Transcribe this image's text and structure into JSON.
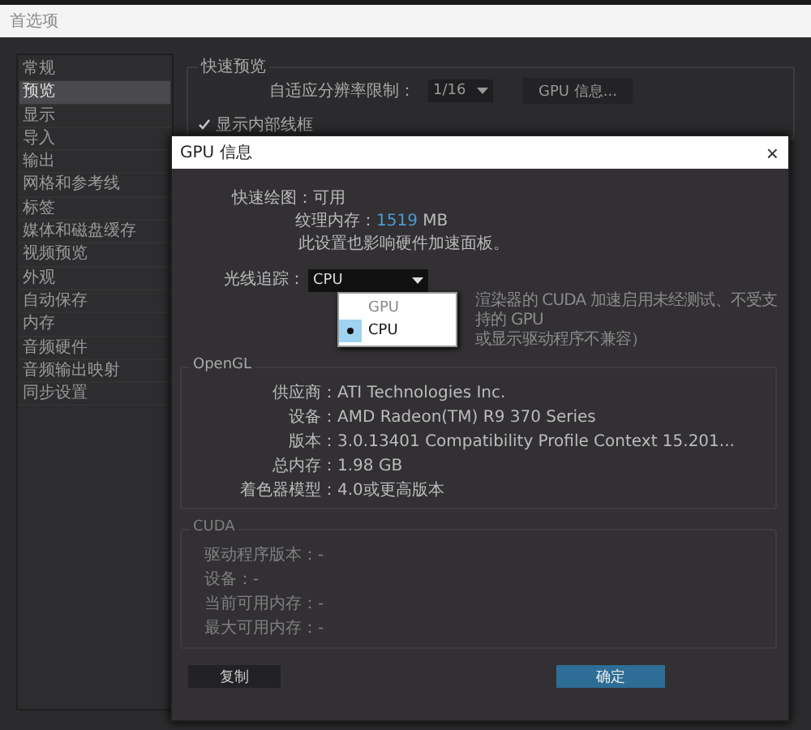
{
  "window": {
    "title": "首选项"
  },
  "sidebar": {
    "items": [
      {
        "label": "常规",
        "selected": false
      },
      {
        "label": "预览",
        "selected": true
      },
      {
        "label": "显示",
        "selected": false
      },
      {
        "label": "导入",
        "selected": false
      },
      {
        "label": "输出",
        "selected": false
      },
      {
        "label": "网格和参考线",
        "selected": false
      },
      {
        "label": "标签",
        "selected": false
      },
      {
        "label": "媒体和磁盘缓存",
        "selected": false
      },
      {
        "label": "视频预览",
        "selected": false
      },
      {
        "label": "外观",
        "selected": false
      },
      {
        "label": "自动保存",
        "selected": false
      },
      {
        "label": "内存",
        "selected": false
      },
      {
        "label": "音频硬件",
        "selected": false
      },
      {
        "label": "音频输出映射",
        "selected": false
      },
      {
        "label": "同步设置",
        "selected": false
      }
    ]
  },
  "preview_group": {
    "title": "快速预览",
    "resolution_label": "自适应分辨率限制：",
    "resolution_value": "1/16",
    "gpu_info_button": "GPU 信息...",
    "show_wireframe": {
      "label": "显示内部线框",
      "checked": true
    }
  },
  "dialog": {
    "title": "GPU 信息",
    "close": "×",
    "fast_draw": "快速绘图：可用",
    "texture_label": "纹理内存：",
    "texture_value": "1519",
    "texture_unit": " MB",
    "note": "此设置也影响硬件加速面板。",
    "raytrace_label": "光线追踪：",
    "raytrace_value": "CPU",
    "raytrace_options": [
      {
        "label": "GPU",
        "selected": false
      },
      {
        "label": "CPU",
        "selected": true
      }
    ],
    "warning_lines": [
      "渲染器的 CUDA 加速启用未经测试、不受支持的 GPU",
      "或显示驱动程序不兼容）"
    ],
    "opengl": {
      "title": "OpenGL",
      "disabled": false,
      "rows": [
        {
          "label": "供应商：",
          "value": "ATI Technologies Inc."
        },
        {
          "label": "设备：",
          "value": "AMD Radeon(TM) R9 370 Series"
        },
        {
          "label": "版本：",
          "value": "3.0.13401 Compatibility Profile Context 15.201..."
        },
        {
          "label": "总内存：",
          "value": "1.98 GB"
        },
        {
          "label": "着色器模型：",
          "value": "4.0或更高版本"
        }
      ]
    },
    "cuda": {
      "title": "CUDA",
      "disabled": true,
      "rows": [
        {
          "text": "驱动程序版本：-"
        },
        {
          "text": "设备：-"
        },
        {
          "text": "当前可用内存：-"
        },
        {
          "text": "最大可用内存：-"
        }
      ]
    },
    "buttons": [
      {
        "label": "复制",
        "kind": "secondary"
      },
      {
        "label": "确定",
        "kind": "primary"
      }
    ]
  }
}
